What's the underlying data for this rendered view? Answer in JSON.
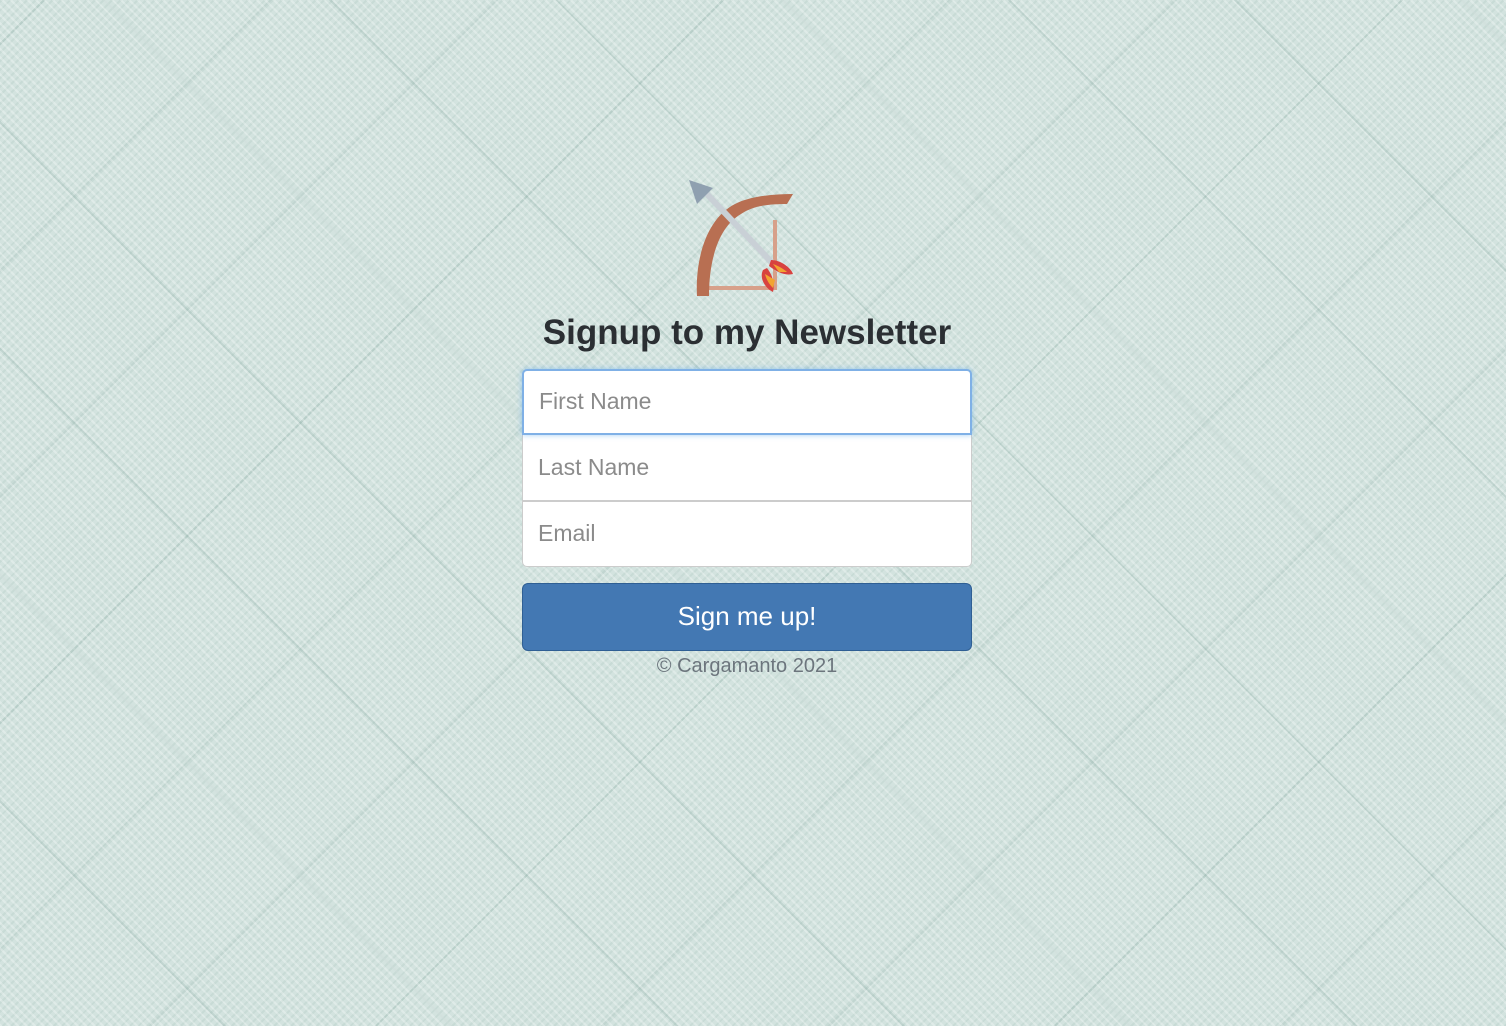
{
  "logo": {
    "icon": "bow-and-arrow-icon"
  },
  "form": {
    "heading": "Signup to my Newsletter",
    "first_name_placeholder": "First Name",
    "last_name_placeholder": "Last Name",
    "email_placeholder": "Email",
    "submit_label": "Sign me up!"
  },
  "footer": {
    "copyright": "© Cargamanto 2021"
  },
  "colors": {
    "button": "#4378b3",
    "focus_border": "#7fb0e6",
    "background": "#d3e3df"
  }
}
